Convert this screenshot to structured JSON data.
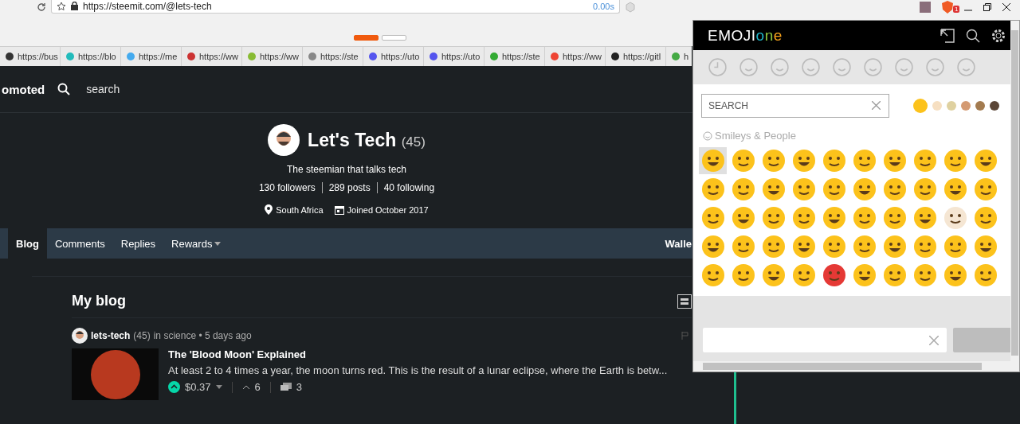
{
  "browser": {
    "url": "https://steemit.com/@lets-tech",
    "load_time": "0.00s",
    "extension_badge": "1",
    "tab_dots": [
      {
        "selected": true
      },
      {
        "selected": false
      }
    ],
    "bookmarks": [
      "https://bus",
      "https://blo",
      "https://me",
      "https://ww",
      "https://ww",
      "https://ste",
      "https://uto",
      "https://uto",
      "https://ste",
      "https://ww",
      "https://gitl",
      "h"
    ]
  },
  "nav": {
    "brand": "omoted",
    "search": "search"
  },
  "profile": {
    "name": "Let's Tech",
    "reputation": "(45)",
    "bio": "The steemian that talks tech",
    "stats": [
      "130 followers",
      "289 posts",
      "40 following"
    ],
    "location": "South Africa",
    "joined": "Joined October 2017"
  },
  "tabs": [
    {
      "label": "Blog",
      "selected": true,
      "dropdown": false
    },
    {
      "label": "Comments",
      "selected": false,
      "dropdown": false
    },
    {
      "label": "Replies",
      "selected": false,
      "dropdown": false
    },
    {
      "label": "Rewards",
      "selected": false,
      "dropdown": true
    }
  ],
  "wallet": "Walle",
  "blog": {
    "heading": "My blog",
    "post": {
      "author": "lets-tech",
      "reputation": "(45)",
      "meta": "in science • 5 days ago",
      "title": "The 'Blood Moon' Explained",
      "excerpt": "At least 2 to 4 times a year, the moon turns red. This is the result of a lunar eclipse, where the Earth is betw...",
      "payout": "$0.37",
      "votes": "6",
      "comments": "3"
    }
  },
  "emoji_panel": {
    "logo": [
      {
        "text": "EMOJI",
        "color": "#ffffff"
      },
      {
        "text": "o",
        "color": "#1fb5c9"
      },
      {
        "text": "n",
        "color": "#8cc63f"
      },
      {
        "text": "e",
        "color": "#f7a21b"
      }
    ],
    "search": {
      "placeholder": "SEARCH"
    },
    "skin_tones": [
      {
        "color": "#fcc21b",
        "selected": true
      },
      {
        "color": "#f6dfc1",
        "selected": false
      },
      {
        "color": "#dfd1a0",
        "selected": false
      },
      {
        "color": "#d49a72",
        "selected": false
      },
      {
        "color": "#a37b4f",
        "selected": false
      },
      {
        "color": "#5b4637",
        "selected": false
      }
    ],
    "category": "Smileys & People",
    "emojis": [
      {
        "color": "#fcc21b",
        "selected": true
      },
      {
        "color": "#fcc21b",
        "selected": false
      },
      {
        "color": "#fcc21b",
        "selected": false
      },
      {
        "color": "#fcc21b",
        "selected": false
      },
      {
        "color": "#fcc21b",
        "selected": false
      },
      {
        "color": "#fcc21b",
        "selected": false
      },
      {
        "color": "#fcc21b",
        "selected": false
      },
      {
        "color": "#fcc21b",
        "selected": false
      },
      {
        "color": "#fcc21b",
        "selected": false
      },
      {
        "color": "#fcc21b",
        "selected": false
      },
      {
        "color": "#fcc21b",
        "selected": false
      },
      {
        "color": "#fcc21b",
        "selected": false
      },
      {
        "color": "#fcc21b",
        "selected": false
      },
      {
        "color": "#fcc21b",
        "selected": false
      },
      {
        "color": "#fcc21b",
        "selected": false
      },
      {
        "color": "#fcc21b",
        "selected": false
      },
      {
        "color": "#fcc21b",
        "selected": false
      },
      {
        "color": "#fcc21b",
        "selected": false
      },
      {
        "color": "#fcc21b",
        "selected": false
      },
      {
        "color": "#fcc21b",
        "selected": false
      },
      {
        "color": "#fcc21b",
        "selected": false
      },
      {
        "color": "#fcc21b",
        "selected": false
      },
      {
        "color": "#fcc21b",
        "selected": false
      },
      {
        "color": "#fcc21b",
        "selected": false
      },
      {
        "color": "#fcc21b",
        "selected": false
      },
      {
        "color": "#fcc21b",
        "selected": false
      },
      {
        "color": "#fcc21b",
        "selected": false
      },
      {
        "color": "#fcc21b",
        "selected": false
      },
      {
        "color": "#f5e6d3",
        "selected": false
      },
      {
        "color": "#fcc21b",
        "selected": false
      },
      {
        "color": "#fcc21b",
        "selected": false
      },
      {
        "color": "#fcc21b",
        "selected": false
      },
      {
        "color": "#fcc21b",
        "selected": false
      },
      {
        "color": "#fcc21b",
        "selected": false
      },
      {
        "color": "#fcc21b",
        "selected": false
      },
      {
        "color": "#fcc21b",
        "selected": false
      },
      {
        "color": "#fcc21b",
        "selected": false
      },
      {
        "color": "#fcc21b",
        "selected": false
      },
      {
        "color": "#fcc21b",
        "selected": false
      },
      {
        "color": "#fcc21b",
        "selected": false
      },
      {
        "color": "#fcc21b",
        "selected": false
      },
      {
        "color": "#fcc21b",
        "selected": false
      },
      {
        "color": "#fcc21b",
        "selected": false
      },
      {
        "color": "#fcc21b",
        "selected": false
      },
      {
        "color": "#e53935",
        "selected": false
      },
      {
        "color": "#fcc21b",
        "selected": false
      },
      {
        "color": "#fcc21b",
        "selected": false
      },
      {
        "color": "#fcc21b",
        "selected": false
      },
      {
        "color": "#fcc21b",
        "selected": false
      },
      {
        "color": "#fcc21b",
        "selected": false
      }
    ]
  }
}
